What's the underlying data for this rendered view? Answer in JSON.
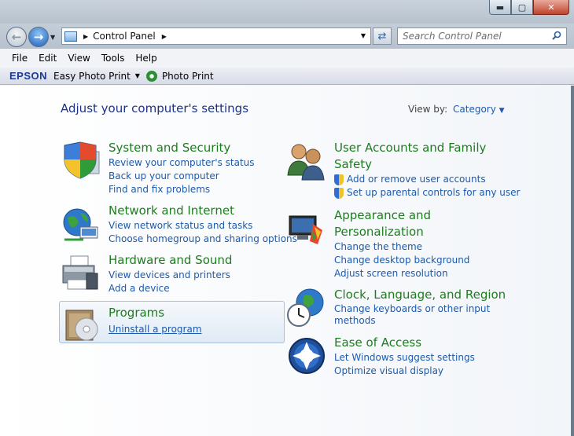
{
  "window": {
    "min_glyph": "▬",
    "max_glyph": "▢",
    "close_glyph": "✕"
  },
  "nav": {
    "breadcrumb": "Control Panel",
    "search_placeholder": "Search Control Panel"
  },
  "menu": [
    "File",
    "Edit",
    "View",
    "Tools",
    "Help"
  ],
  "epson": {
    "logo": "EPSON",
    "easy_photo_print": "Easy Photo Print",
    "photo_print": "Photo Print"
  },
  "page": {
    "heading": "Adjust your computer's settings",
    "view_by_label": "View by:",
    "view_by_value": "Category"
  },
  "categories": {
    "system_security": {
      "title": "System and Security",
      "links": [
        "Review your computer's status",
        "Back up your computer",
        "Find and fix problems"
      ]
    },
    "network_internet": {
      "title": "Network and Internet",
      "links": [
        "View network status and tasks",
        "Choose homegroup and sharing options"
      ]
    },
    "hardware_sound": {
      "title": "Hardware and Sound",
      "links": [
        "View devices and printers",
        "Add a device"
      ]
    },
    "programs": {
      "title": "Programs",
      "links": [
        "Uninstall a program"
      ]
    },
    "user_accounts": {
      "title_line1": "User Accounts and Family",
      "title_line2": "Safety",
      "links": [
        "Add or remove user accounts",
        "Set up parental controls for any user"
      ]
    },
    "appearance": {
      "title_line1": "Appearance and",
      "title_line2": "Personalization",
      "links": [
        "Change the theme",
        "Change desktop background",
        "Adjust screen resolution"
      ]
    },
    "clock_language": {
      "title": "Clock, Language, and Region",
      "link_line1": "Change keyboards or other input",
      "link_line2": "methods"
    },
    "ease_access": {
      "title": "Ease of Access",
      "links": [
        "Let Windows suggest settings",
        "Optimize visual display"
      ]
    }
  },
  "colors": {
    "heading": "#1e3287",
    "category_title": "#1e7d1e",
    "link": "#1d5aab"
  }
}
